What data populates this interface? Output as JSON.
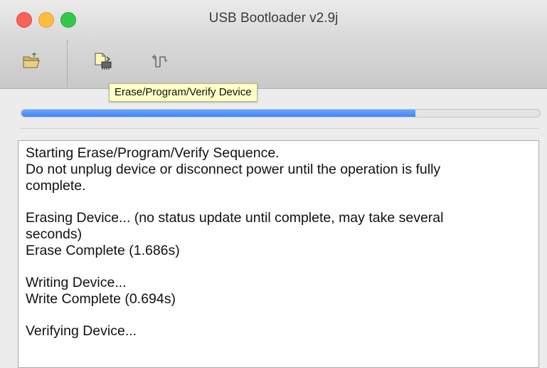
{
  "window": {
    "title": "USB Bootloader v2.9j"
  },
  "toolbar": {
    "tools": [
      {
        "icon": "open-folder-icon"
      },
      {
        "icon": "erase-program-verify-icon"
      },
      {
        "icon": "reset-device-icon"
      }
    ],
    "tooltip": "Erase/Program/Verify Device"
  },
  "progress": {
    "value": 0.76,
    "color": "#3e86f7"
  },
  "log": {
    "lines": [
      "Starting Erase/Program/Verify Sequence.",
      "Do not unplug device or disconnect power until the operation is fully",
      "complete.",
      "",
      "Erasing Device... (no status update until complete, may take several",
      "seconds)",
      "Erase Complete (1.686s)",
      "",
      "Writing Device...",
      "Write Complete (0.694s)",
      "",
      "Verifying Device..."
    ]
  }
}
